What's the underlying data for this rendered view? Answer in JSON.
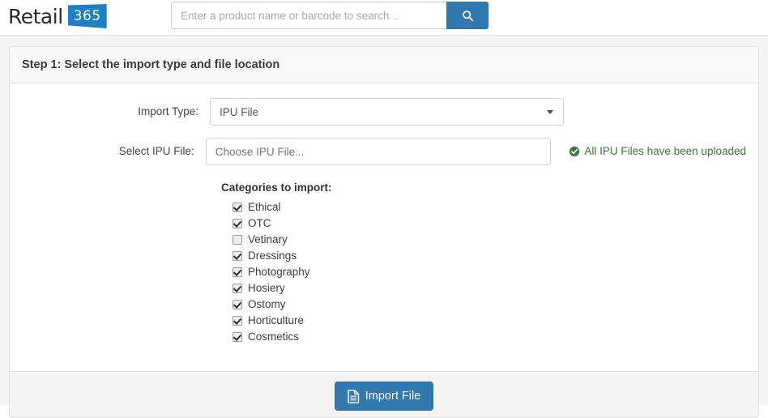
{
  "brand": {
    "word": "Retail",
    "badge": "365"
  },
  "search": {
    "placeholder": "Enter a product name or barcode to search...",
    "value": "",
    "button_icon": "search-icon"
  },
  "panel": {
    "title": "Step 1: Select the import type and file location",
    "fields": [
      {
        "label": "Import Type:",
        "control": "select",
        "value": "IPU File",
        "caret_icon": "chevron-down-icon"
      },
      {
        "label": "Select IPU File:",
        "control": "input",
        "value": "",
        "placeholder": "Choose IPU File..."
      }
    ],
    "status": {
      "icon": "check-circle-icon",
      "text": "All IPU Files have been uploaded",
      "color": "#3c763d"
    },
    "categories": {
      "title": "Categories to import:",
      "items": [
        {
          "label": "Ethical",
          "checked": true
        },
        {
          "label": "OTC",
          "checked": true
        },
        {
          "label": "Vetinary",
          "checked": false
        },
        {
          "label": "Dressings",
          "checked": true
        },
        {
          "label": "Photography",
          "checked": true
        },
        {
          "label": "Hosiery",
          "checked": true
        },
        {
          "label": "Ostomy",
          "checked": true
        },
        {
          "label": "Horticulture",
          "checked": true
        },
        {
          "label": "Cosmetics",
          "checked": true
        }
      ]
    },
    "footer": {
      "import_button": {
        "label": "Import File",
        "icon": "file-text-icon"
      }
    }
  },
  "colors": {
    "accent_blue": "#3179ae",
    "brand_blue": "#1f7fc4",
    "success_green": "#3c763d",
    "page_bg": "#f4f4f4"
  }
}
